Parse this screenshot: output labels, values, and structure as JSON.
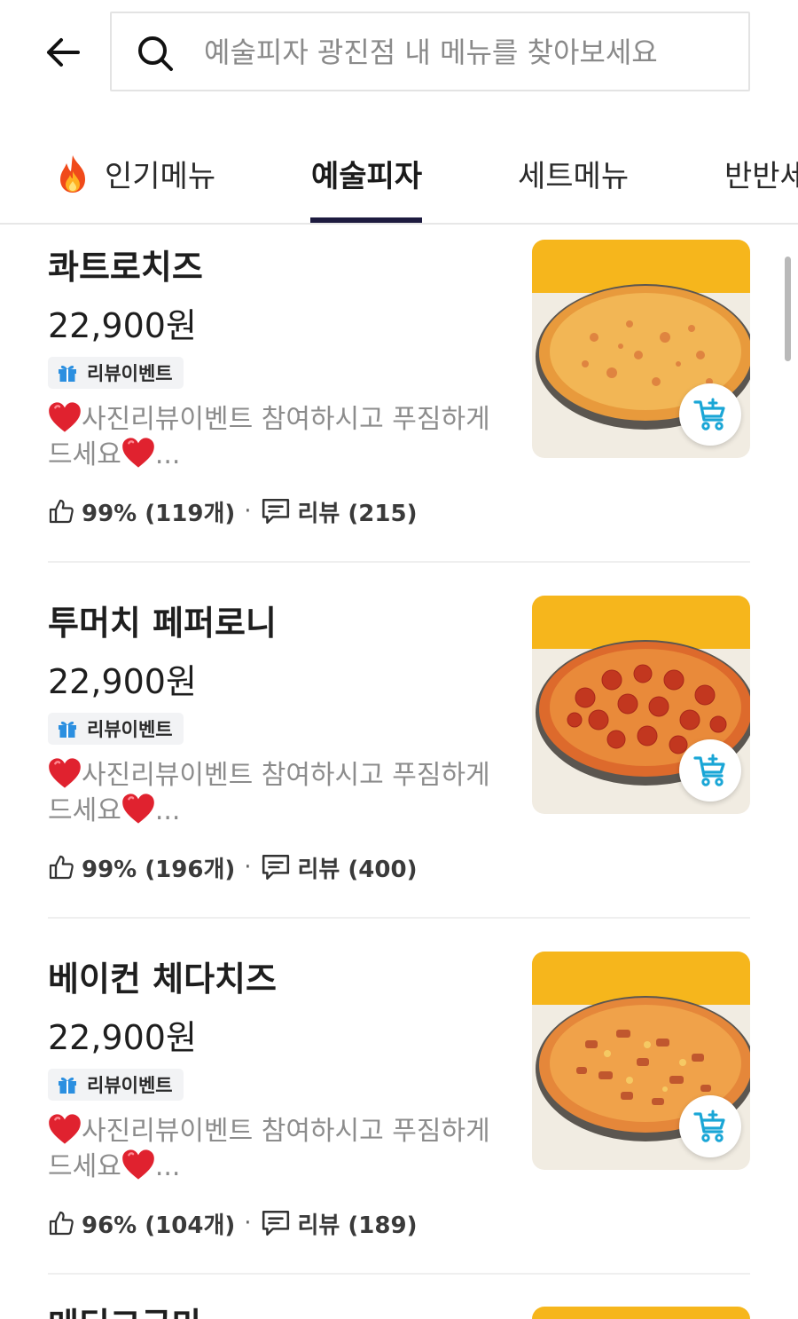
{
  "header": {
    "search_placeholder": "예술피자 광진점 내 메뉴를 찾아보세요"
  },
  "tabs": [
    {
      "label": "인기메뉴",
      "active": false,
      "icon": "fire-icon"
    },
    {
      "label": "예술피자",
      "active": true
    },
    {
      "label": "세트메뉴",
      "active": false
    },
    {
      "label": "반반세",
      "active": false
    }
  ],
  "menu": {
    "items": [
      {
        "name": "콰트로치즈",
        "price": "22,900원",
        "badge": "리뷰이벤트",
        "description_line1": "사진리뷰이벤트 참여하시고 푸짐하게",
        "description_line2": "드세요",
        "description_tail": "...",
        "like_stat": "99% (119개)",
        "review_stat": "리뷰 (215)",
        "image": "cheese-pizza"
      },
      {
        "name": "투머치 페퍼로니",
        "price": "22,900원",
        "badge": "리뷰이벤트",
        "description_line1": "사진리뷰이벤트 참여하시고 푸짐하게",
        "description_line2": "드세요",
        "description_tail": "...",
        "like_stat": "99% (196개)",
        "review_stat": "리뷰 (400)",
        "image": "pepperoni-pizza"
      },
      {
        "name": "베이컨 체다치즈",
        "price": "22,900원",
        "badge": "리뷰이벤트",
        "description_line1": "사진리뷰이벤트 참여하시고 푸짐하게",
        "description_line2": "드세요",
        "description_tail": "...",
        "like_stat": "96% (104개)",
        "review_stat": "리뷰 (189)",
        "image": "bacon-cheddar-pizza"
      }
    ],
    "partial_next_name": "메딕고구마"
  },
  "colors": {
    "accent": "#1d1b3f",
    "cart_icon": "#1aa6d6",
    "gift_icon": "#2b8fe0",
    "heart": "#e0222f",
    "image_bg_top": "#f6b61c",
    "image_bg_bottom": "#f1ece2"
  }
}
